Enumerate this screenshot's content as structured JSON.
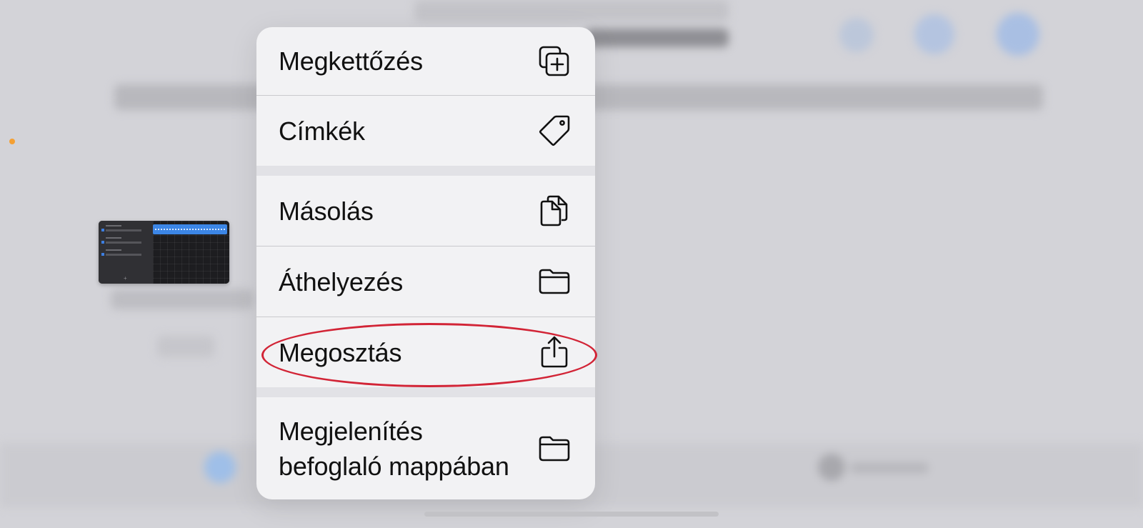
{
  "menu": {
    "items": [
      {
        "label": "Megkettőzés",
        "icon": "duplicate-icon"
      },
      {
        "label": "Címkék",
        "icon": "tag-icon"
      },
      {
        "label": "Másolás",
        "icon": "copy-icon"
      },
      {
        "label": "Áthelyezés",
        "icon": "folder-icon"
      },
      {
        "label": "Megosztás",
        "icon": "share-icon"
      },
      {
        "label_line1": "Megjelenítés",
        "label_line2": "befoglaló mappában",
        "icon": "folder-icon"
      }
    ]
  },
  "colors": {
    "accent_orange": "#f5a033",
    "annotation_red": "#d22436",
    "menu_background": "#f2f2f4",
    "region_blue": "#3c86e6"
  }
}
